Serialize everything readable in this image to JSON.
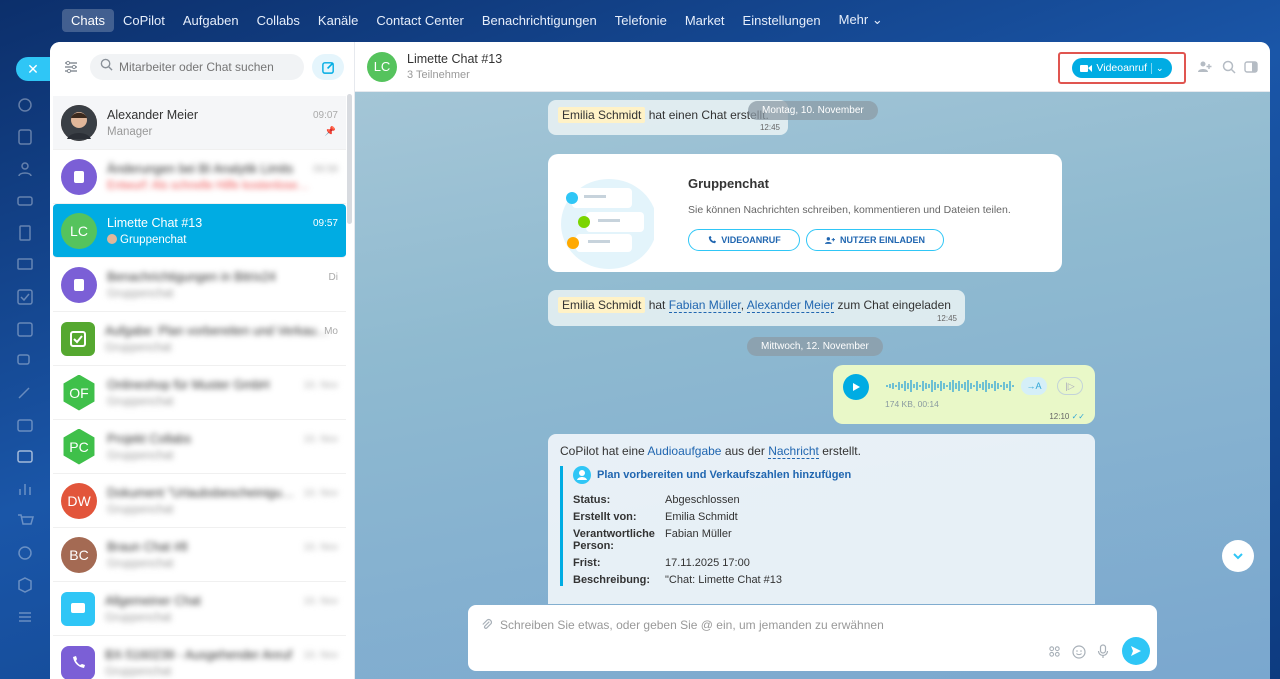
{
  "topnav": {
    "items": [
      "Chats",
      "CoPilot",
      "Aufgaben",
      "Collabs",
      "Kanäle",
      "Contact Center",
      "Benachrichtigungen",
      "Telefonie",
      "Market",
      "Einstellungen",
      "Mehr ⌄"
    ]
  },
  "sidebar": {
    "search_placeholder": "Mitarbeiter oder Chat suchen",
    "chats": [
      {
        "name": "Alexander Meier",
        "sub": "Manager",
        "time": "09:07",
        "initials": "",
        "color": "#6b4f3a"
      },
      {
        "name": "Änderungen bei BI Analytik Limits",
        "sub": "Entwurf: Als schnelle Hilfe kostenlose…",
        "time": "09:58",
        "initials": "",
        "color": "#7b5fd6"
      },
      {
        "name": "Limette Chat #13",
        "sub": "Gruppenchat",
        "time": "09:57",
        "initials": "LC",
        "color": "#55c35d"
      },
      {
        "name": "Benachrichtigungen in Bitrix24",
        "sub": "Gruppenchat",
        "time": "Di",
        "initials": "",
        "color": "#7b5fd6"
      },
      {
        "name": "Aufgabe: Plan vorbereiten und Verkau…",
        "sub": "Gruppenchat",
        "time": "Mo",
        "initials": "",
        "color": "#55a830"
      },
      {
        "name": "Onlineshop für Muster GmbH",
        "sub": "Gruppenchat",
        "time": "10. Nov",
        "initials": "OF",
        "color": "#3fc04a"
      },
      {
        "name": "Projekt Collabs",
        "sub": "Gruppenchat",
        "time": "10. Nov",
        "initials": "PC",
        "color": "#3fc04a"
      },
      {
        "name": "Dokument \"Urlaubsbescheinigu…",
        "sub": "Gruppenchat",
        "time": "10. Nov",
        "initials": "DW",
        "color": "#e2553b"
      },
      {
        "name": "Braun Chat #8",
        "sub": "Gruppenchat",
        "time": "10. Nov",
        "initials": "BC",
        "color": "#a46a53"
      },
      {
        "name": "Allgemeiner Chat",
        "sub": "Gruppenchat",
        "time": "10. Nov",
        "initials": "",
        "color": "#2fc6f6"
      },
      {
        "name": "BX-5160239 - Ausgehender Anruf",
        "sub": "Gruppenchat",
        "time": "10. Nov",
        "initials": "",
        "color": "#7b5fd6"
      }
    ]
  },
  "header": {
    "avatar": "LC",
    "title": "Limette Chat #13",
    "subtitle": "3 Teilnehmer",
    "video_label": "Videoanruf"
  },
  "messages": {
    "sep1": "Montag, 10. November",
    "created_user": "Emilia Schmidt",
    "created_text": "hat einen Chat erstellt.",
    "created_time": "12:45",
    "card_title": "Gruppenchat",
    "card_text": "Sie können Nachrichten schreiben, kommentieren und Dateien teilen.",
    "card_btn_video": "VIDEOANRUF",
    "card_btn_invite": "NUTZER EINLADEN",
    "invite_user": "Emilia Schmidt",
    "invite_verb": "hat",
    "invite_p1": "Fabian Müller",
    "invite_p2": "Alexander Meier",
    "invite_tail": "zum Chat eingeladen",
    "invite_time": "12:45",
    "sep2": "Mittwoch, 12. November",
    "voice_meta": "174 KB, 00:14",
    "voice_time": "12:10",
    "task_intro_a": "CoPilot hat eine",
    "task_intro_link1": "Audioaufgabe",
    "task_intro_b": "aus der",
    "task_intro_link2": "Nachricht",
    "task_intro_c": "erstellt.",
    "task_title": "Plan vorbereiten und Verkaufszahlen hinzufügen",
    "rows": [
      {
        "k": "Status:",
        "v": "Abgeschlossen"
      },
      {
        "k": "Erstellt von:",
        "v": "Emilia Schmidt"
      },
      {
        "k": "Verantwortliche Person:",
        "v": "Fabian Müller"
      },
      {
        "k": "Frist:",
        "v": "17.11.2025 17:00"
      },
      {
        "k": "Beschreibung:",
        "v": "\"Chat: Limette Chat #13"
      }
    ]
  },
  "composer": {
    "placeholder": "Schreiben Sie etwas, oder geben Sie @ ein, um jemanden zu erwähnen"
  }
}
